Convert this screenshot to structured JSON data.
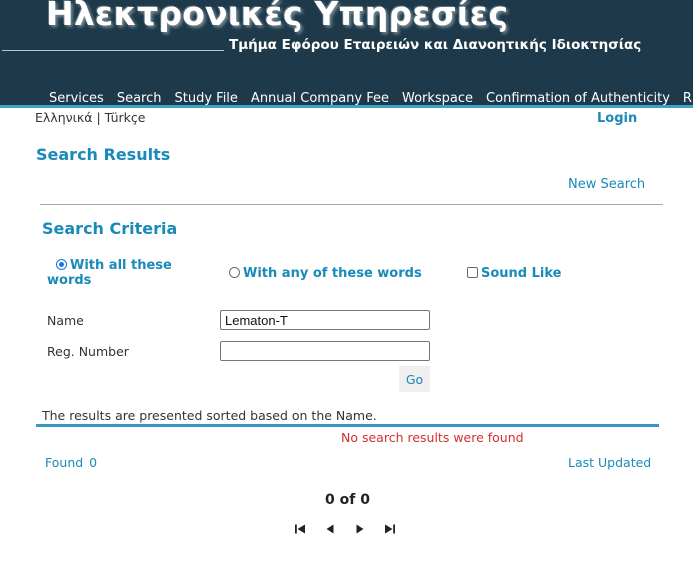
{
  "header": {
    "title": "Ηλεκτρονικές Υπηρεσίες",
    "subtitle": "Τμήμα Εφόρου Εταιρειών και Διανοητικής Ιδιοκτησίας",
    "nav": [
      "Services",
      "Search",
      "Study File",
      "Annual Company Fee",
      "Workspace",
      "Confirmation of Authenticity",
      "R"
    ]
  },
  "languages": {
    "greek": "Ελληνικά",
    "separator": "|",
    "turkish": "Türkçe"
  },
  "login_label": "Login",
  "page_title": "Search Results",
  "new_search_label": "New Search",
  "criteria": {
    "title": "Search Criteria",
    "options": [
      {
        "label": "With all these words",
        "selected": true,
        "kind": "radio"
      },
      {
        "label": "With any of these words",
        "selected": false,
        "kind": "radio"
      },
      {
        "label": "Sound Like",
        "selected": false,
        "kind": "checkbox"
      }
    ],
    "name_label": "Name",
    "name_value": "Lematon-T",
    "reg_label": "Reg. Number",
    "reg_value": "",
    "go_label": "Go"
  },
  "results": {
    "sort_note": "The results are presented sorted based on the Name.",
    "no_results": "No search results were found",
    "found_label": "Found",
    "found_count": "0",
    "last_updated_label": "Last Updated",
    "page_info": "0 of 0"
  },
  "colors": {
    "header_bg": "#1e3a4a",
    "accent": "#1a8ab8",
    "error": "#d32f2f"
  },
  "icons": [
    "first-page-icon",
    "previous-page-icon",
    "next-page-icon",
    "last-page-icon"
  ]
}
